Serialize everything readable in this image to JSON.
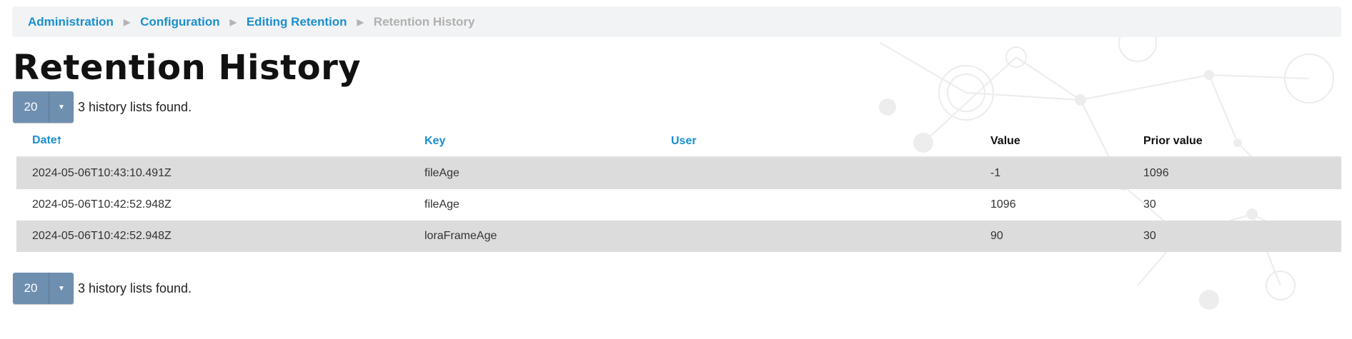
{
  "breadcrumb": {
    "items": [
      "Administration",
      "Configuration",
      "Editing Retention"
    ],
    "current": "Retention History"
  },
  "page_title": "Retention History",
  "pager": {
    "page_size": "20",
    "found_text": "3 history lists found."
  },
  "table": {
    "headers": {
      "date": "Date",
      "key": "Key",
      "user": "User",
      "value": "Value",
      "prior_value": "Prior value"
    },
    "sort": {
      "column": "Date",
      "direction": "ascending"
    },
    "rows": [
      {
        "date": "2024-05-06T10:43:10.491Z",
        "key": "fileAge",
        "user": "",
        "value": "-1",
        "prior_value": "1096"
      },
      {
        "date": "2024-05-06T10:42:52.948Z",
        "key": "fileAge",
        "user": "",
        "value": "1096",
        "prior_value": "30"
      },
      {
        "date": "2024-05-06T10:42:52.948Z",
        "key": "loraFrameAge",
        "user": "",
        "value": "90",
        "prior_value": "30"
      }
    ]
  },
  "icons": {
    "crumb_separator": "triangle-right-icon",
    "sort_arrow": "arrow-up-icon",
    "dropdown": "caret-down-icon"
  },
  "colors": {
    "link": "#1a8fd0",
    "pager_button": "#6f8fb0",
    "row_shade": "#dcdcdc",
    "breadcrumb_bg": "#f2f3f4"
  }
}
